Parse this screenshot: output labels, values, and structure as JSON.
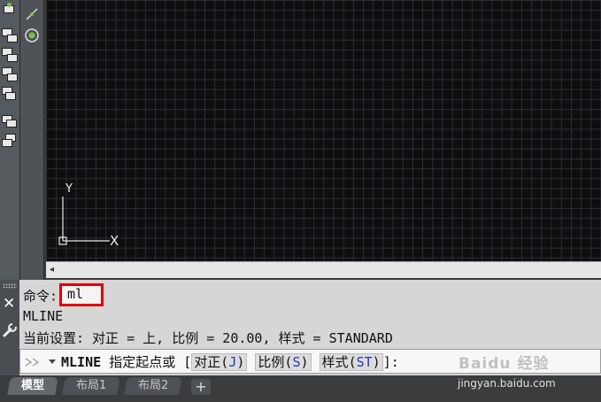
{
  "commands": {
    "history": [
      {
        "label": "命令:",
        "value": "ml"
      },
      {
        "label": "MLINE"
      },
      {
        "label": "当前设置: 对正 = 上, 比例 = 20.00, 样式 = STANDARD"
      }
    ],
    "prompt": {
      "command": "MLINE",
      "text": "指定起点或",
      "open_bracket": "[",
      "options": [
        {
          "name": "对正",
          "key": "J"
        },
        {
          "name": "比例",
          "key": "S"
        },
        {
          "name": "样式",
          "key": "ST"
        }
      ],
      "close_bracket": "]:"
    },
    "close_icon": "✕"
  },
  "ucs": {
    "x_label": "X",
    "y_label": "Y"
  },
  "tabs": [
    {
      "label": "模型",
      "active": true
    },
    {
      "label": "布局1",
      "active": false
    },
    {
      "label": "布局2",
      "active": false
    }
  ],
  "tab_add_label": "+",
  "watermark": {
    "brand": "Baidu 经验",
    "url": "jingyan.baidu.com"
  },
  "colors": {
    "canvas": "#0e0e10",
    "grid": "#2b2e33",
    "highlight_box": "#e00000",
    "option_key": "#2437b8"
  }
}
